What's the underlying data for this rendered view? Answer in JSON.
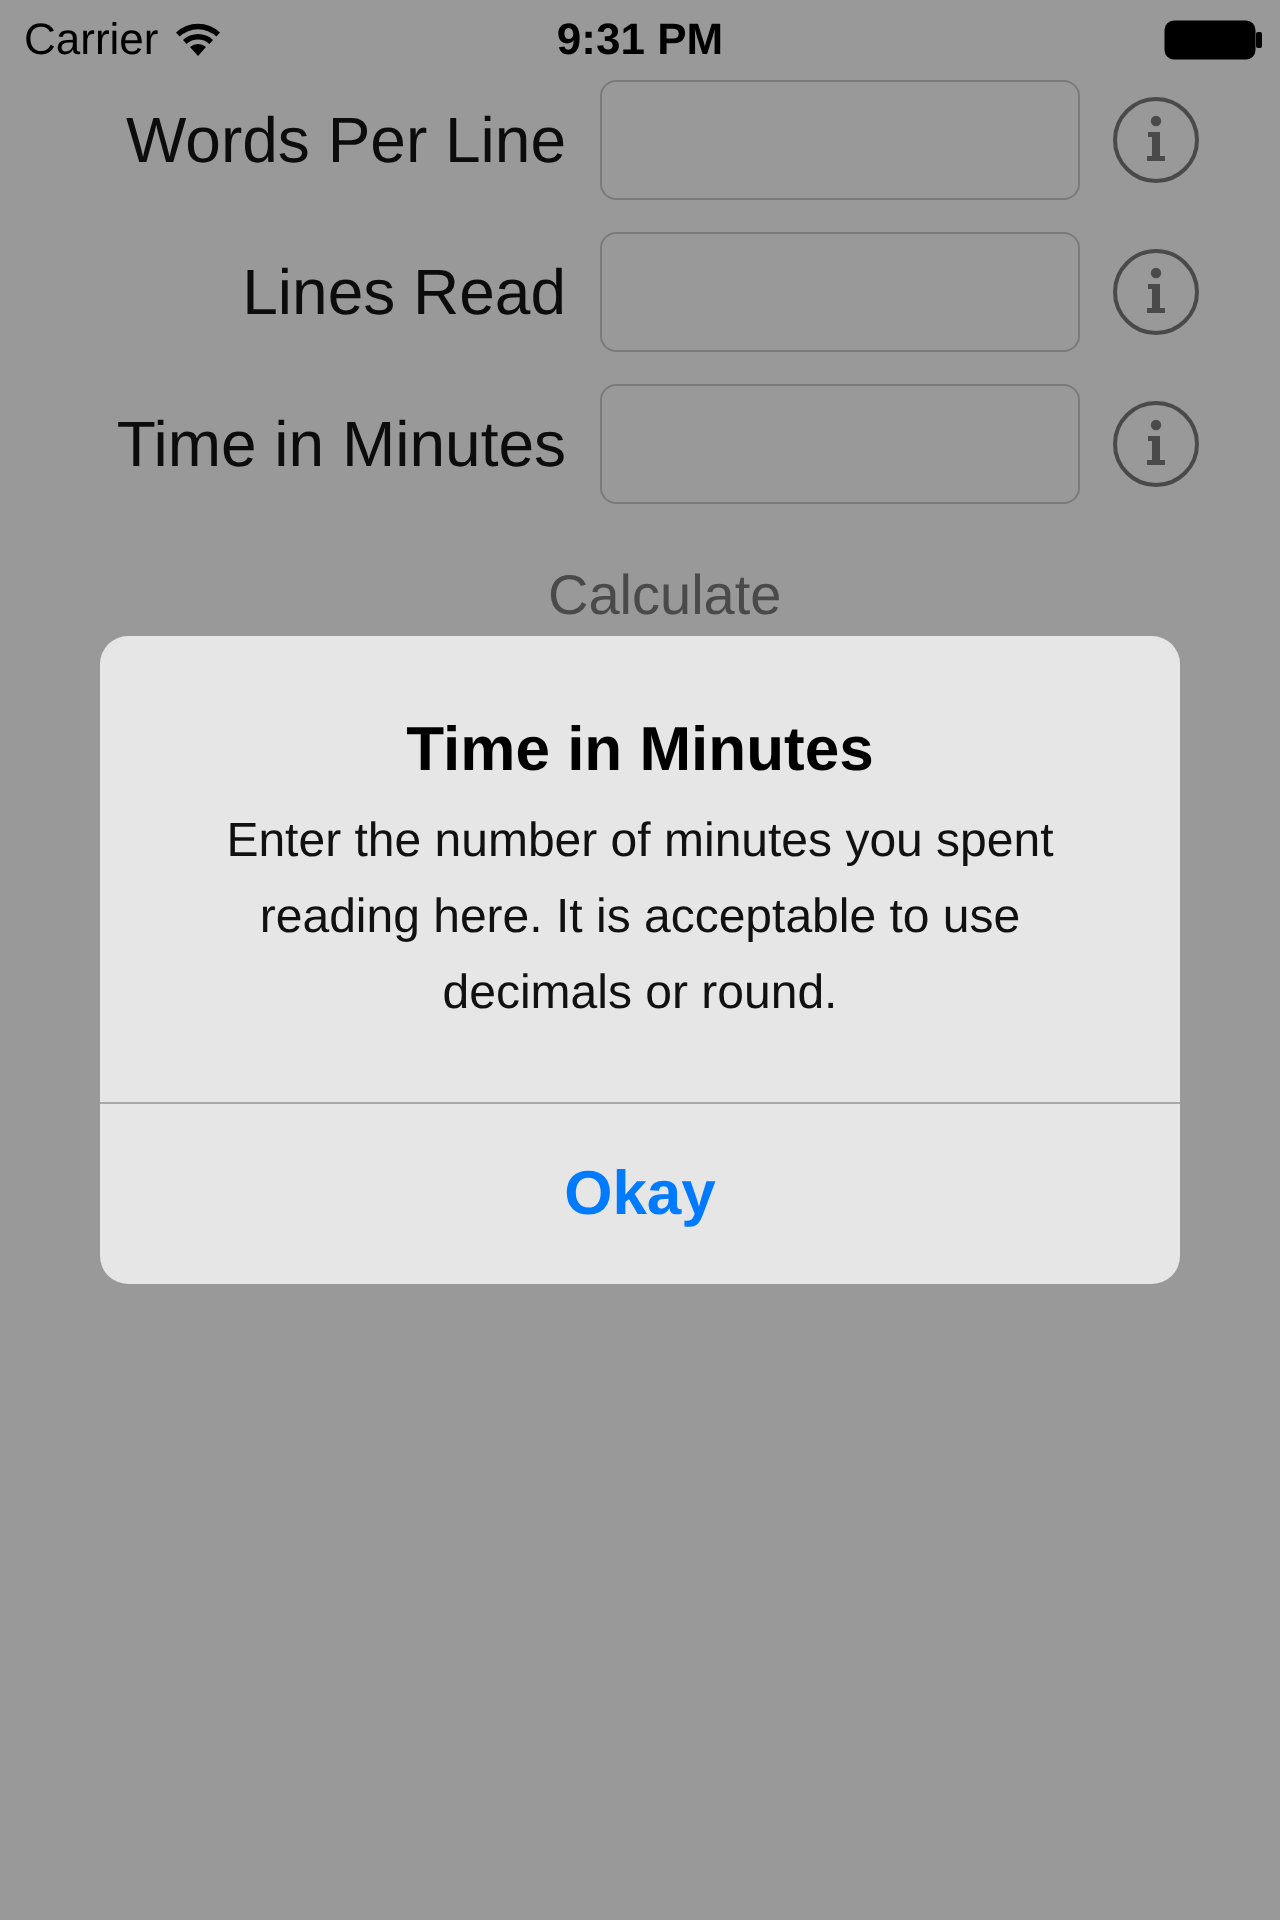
{
  "status_bar": {
    "carrier": "Carrier",
    "time": "9:31 PM"
  },
  "fields": [
    {
      "label": "Words Per Line"
    },
    {
      "label": "Lines Read"
    },
    {
      "label": "Time in Minutes"
    }
  ],
  "calculate_button": "Calculate",
  "alert": {
    "title": "Time in Minutes",
    "message": "Enter the number of minutes you spent reading here. It is acceptable to use decimals or round.",
    "button": "Okay"
  }
}
